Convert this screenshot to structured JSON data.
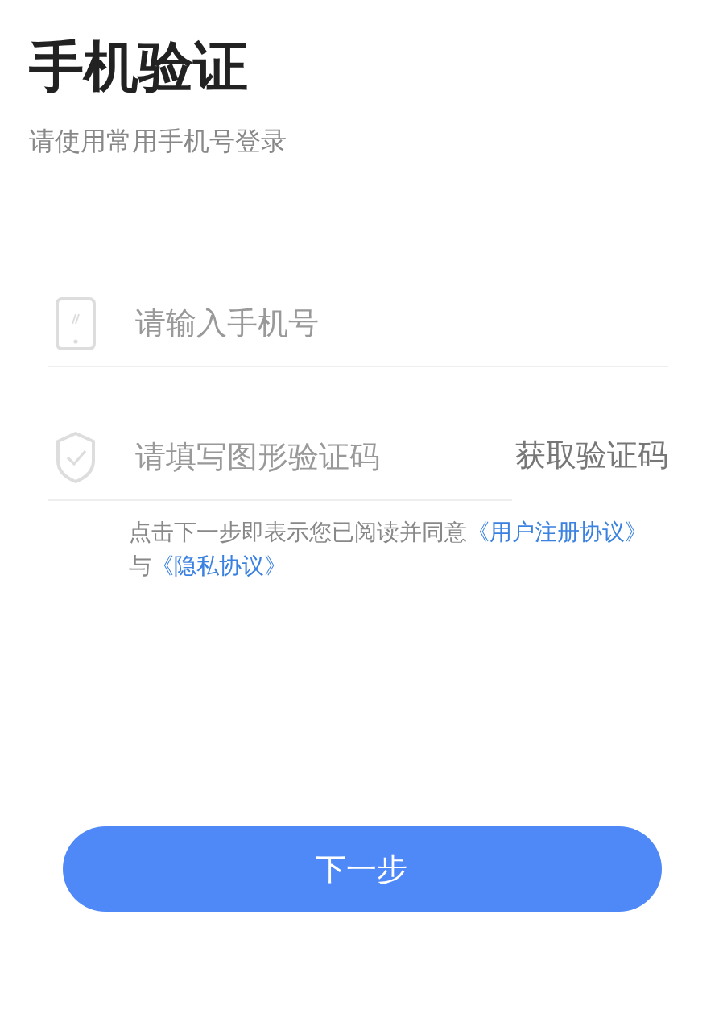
{
  "title": "手机验证",
  "subtitle": "请使用常用手机号登录",
  "phone_field": {
    "placeholder": "请输入手机号"
  },
  "captcha_field": {
    "placeholder": "请填写图形验证码"
  },
  "get_code_button": "获取验证码",
  "agreement": [
    {
      "kind": "text",
      "text": "点击下一步即表示您已阅读并同意"
    },
    {
      "kind": "link",
      "text": "《用户注册协议》"
    },
    {
      "kind": "text",
      "text": "与"
    },
    {
      "kind": "link",
      "text": "《隐私协议》"
    }
  ],
  "next_button": "下一步"
}
